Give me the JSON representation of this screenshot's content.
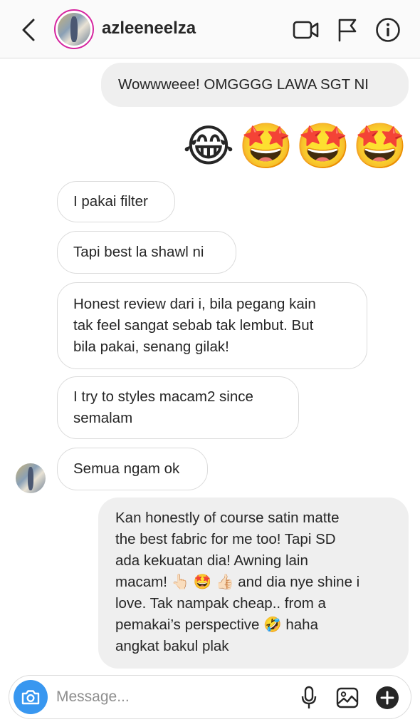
{
  "header": {
    "username": "azleeneelza",
    "icons": [
      "back-icon",
      "video-call-icon",
      "flag-icon",
      "info-icon"
    ]
  },
  "messages": [
    {
      "direction": "outgoing",
      "text": "Wowwweee! OMGGGG LAWA SGT NI"
    },
    {
      "direction": "outgoing",
      "emojis": [
        "😂",
        "🤩",
        "🤩",
        "🤩"
      ]
    },
    {
      "direction": "incoming",
      "text": "I pakai filter"
    },
    {
      "direction": "incoming",
      "text": "Tapi best la shawl ni"
    },
    {
      "direction": "incoming",
      "lines": [
        "Honest review dari i, bila pegang kain",
        "tak feel sangat sebab tak lembut. But",
        "bila pakai, senang gilak!"
      ]
    },
    {
      "direction": "incoming",
      "lines": [
        "I try to styles macam2 since",
        "semalam"
      ]
    },
    {
      "direction": "incoming",
      "text": "Semua ngam ok"
    },
    {
      "direction": "outgoing",
      "lines": [
        "Kan honestly of course satin matte",
        "the best fabric for me too! Tapi SD",
        "ada kekuatan dia! Awning lain",
        "macam! 👆🏻 🤩 👍🏻 and dia nye shine i",
        "love. Tak nampak cheap.. from a",
        "pemakai’s perspective 🤣 haha",
        "angkat bakul plak"
      ]
    }
  ],
  "composer": {
    "placeholder": "Message...",
    "value": ""
  },
  "colors": {
    "accent": "#3897f0",
    "outgoing_bubble": "#efefef",
    "incoming_border": "#dbdbdb",
    "story_ring": "#d6249f",
    "text": "#262626",
    "placeholder": "#8e8e8e"
  }
}
